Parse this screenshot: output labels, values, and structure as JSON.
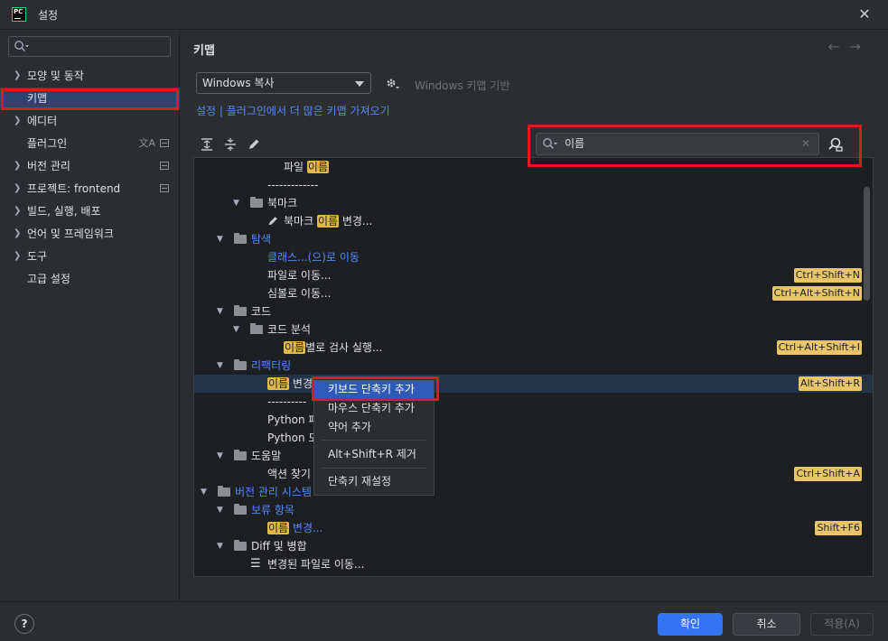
{
  "window": {
    "title": "설정",
    "logo": "PC"
  },
  "sidebar": {
    "items": [
      {
        "label": "모양 및 동작",
        "expandable": true
      },
      {
        "label": "키맵",
        "expandable": false,
        "selected": true
      },
      {
        "label": "에디터",
        "expandable": true
      },
      {
        "label": "플러그인",
        "expandable": false
      },
      {
        "label": "버전 관리",
        "expandable": true
      },
      {
        "label": "프로젝트: frontend",
        "expandable": true
      },
      {
        "label": "빌드, 실행, 배포",
        "expandable": true
      },
      {
        "label": "언어 및 프레임워크",
        "expandable": true
      },
      {
        "label": "도구",
        "expandable": true
      },
      {
        "label": "고급 설정",
        "expandable": false
      }
    ]
  },
  "main": {
    "title": "키맵",
    "keymap_value": "Windows 복사",
    "based_on": "Windows 키맵 기반",
    "links_text": "설정 | 플러그인에서 더 많은 키맵 가져오기",
    "search_value": "이름"
  },
  "tree": {
    "r0": {
      "pre": "파일 ",
      "hl": "이름",
      "post": ""
    },
    "r1": "-------------",
    "r2": "북마크",
    "r3": {
      "pre": "북마크 ",
      "hl": "이름",
      "post": " 변경..."
    },
    "r4": "탐색",
    "r5": "클래스...(으)로 이동",
    "r6": {
      "text": "파일로 이동...",
      "shortcut": "Ctrl+Shift+N"
    },
    "r7": {
      "text": "심볼로 이동...",
      "shortcut": "Ctrl+Alt+Shift+N"
    },
    "r8": "코드",
    "r9": "코드 분석",
    "r10": {
      "hl": "이름",
      "post": "별로 검사 실행...",
      "shortcut": "Ctrl+Alt+Shift+I"
    },
    "r11": "리팩터링",
    "r12": {
      "hl": "이름",
      "post": " 변경",
      "shortcut": "Alt+Shift+R"
    },
    "r13": "----------",
    "r14": "Python 패",
    "r15": "Python 모",
    "r16": "도움말",
    "r17": {
      "text": "액션 찾기",
      "shortcut": "Ctrl+Shift+A"
    },
    "r18": "버전 관리 시스템",
    "r19": "보류 항목",
    "r20": {
      "hl": "이름",
      "post": " 변경...",
      "shortcut": "Shift+F6"
    },
    "r21": "Diff 및 병합",
    "r22": "변경된 파일로 이동..."
  },
  "context_menu": {
    "items": [
      "키보드 단축키 추가",
      "마우스 단축키 추가",
      "약어 추가",
      "Alt+Shift+R 제거",
      "단축키 재설정"
    ]
  },
  "footer": {
    "help": "?",
    "ok": "확인",
    "cancel": "취소",
    "apply": "적용(A)"
  },
  "colors": {
    "accent": "#3574f0",
    "highlight": "#e1b84a",
    "link": "#548af7",
    "annotation": "#e0191e"
  }
}
